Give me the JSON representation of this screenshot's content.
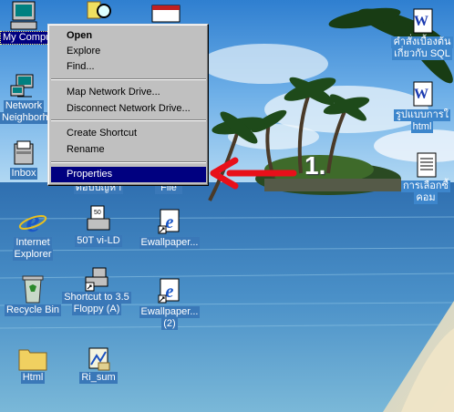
{
  "context_menu": {
    "items": [
      {
        "label": "Open",
        "bold": true
      },
      {
        "label": "Explore"
      },
      {
        "label": "Find..."
      },
      {
        "label": "Map Network Drive..."
      },
      {
        "label": "Disconnect Network Drive..."
      },
      {
        "label": "Create Shortcut"
      },
      {
        "label": "Rename"
      },
      {
        "label": "Properties",
        "highlighted": true
      }
    ]
  },
  "annotation": {
    "step": "1.",
    "arrow_color": "#e8101a"
  },
  "desktop_icons": {
    "my_computer": "My Computer",
    "network_neighborhood_line1": "Network",
    "network_neighborhood_line2": "Neighborhood",
    "inbox": "Inbox",
    "internet_explorer_line1": "Internet",
    "internet_explorer_line2": "Explorer",
    "recycle_bin": "Recycle Bin",
    "html_folder": "Html",
    "col2_hidden_label": "ตอบปัญหา",
    "vi_ld": "50T vi-LD",
    "shortcut_floppy_line1": "Shortcut to 3.5",
    "shortcut_floppy_line2": "Floppy (A)",
    "ri_sum": "Ri_sum",
    "col3_hidden_label": "File",
    "ewallpaper1": "Ewallpaper...",
    "ewallpaper2_line1": "Ewallpaper...",
    "ewallpaper2_line2": "(2)",
    "right1_line1": "คำสั่งเบื้องต้น",
    "right1_line2": "เกี่ยวกับ SQL",
    "right2_line1": "รูปแบบการใ",
    "right2_line2": "html",
    "right3_line1": "การเลือกซื้",
    "right3_line2": "คอม"
  },
  "colors": {
    "menu_highlight": "#000080",
    "menu_bg": "#c0c0c0",
    "desktop_label_selected": "#000080"
  }
}
